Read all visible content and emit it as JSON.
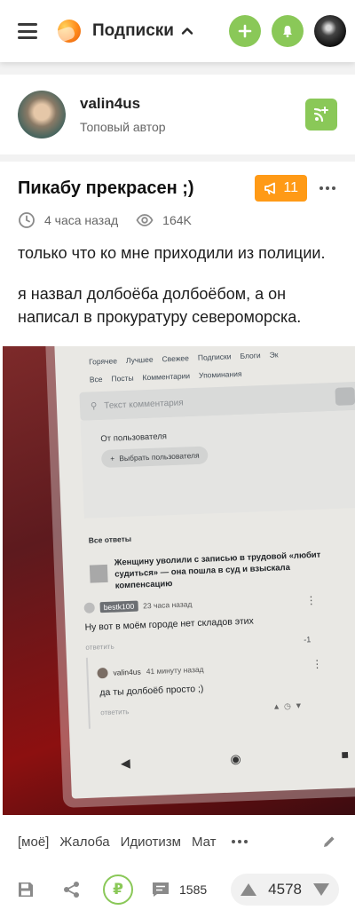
{
  "header": {
    "section_label": "Подписки",
    "icons": {
      "menu": "burger-menu-icon",
      "logo": "pikabu-logo",
      "chevron": "chevron-up-icon",
      "add": "plus-icon",
      "notifications": "bell-icon",
      "profile": "user-avatar"
    },
    "accent_color": "#8ac858"
  },
  "author": {
    "name": "valin4us",
    "rank": "Топовый автор",
    "subscribe_icon": "subscribe-rss-icon"
  },
  "story": {
    "title": "Пикабу прекрасен ;)",
    "rating_badge": "11",
    "rating_badge_color": "#ff9a16",
    "time_ago": "4 часа назад",
    "views": "164K",
    "paragraphs": [
      "только что ко мне приходили из полиции.",
      "я назвал долбоёба долбоёбом, а он написал в прокуратуру североморска."
    ]
  },
  "photo": {
    "nav_top": [
      "Горячее",
      "Лучшее",
      "Свежее",
      "Подписки",
      "Блоги",
      "Эк"
    ],
    "nav_sub": [
      "Все",
      "Посты",
      "Комментарии",
      "Упоминания"
    ],
    "search_placeholder": "Текст комментария",
    "filter_title": "От пользователя",
    "filter_button": "Выбрать пользователя",
    "all_answers": "Все ответы",
    "post_title": "Женщину уволили с записью в трудовой «любит судиться» — она пошла в суд и взыскала компенсацию",
    "comment1": {
      "user": "bestk100",
      "time": "23 часа назад",
      "text": "Ну вот в моём городе нет складов этих",
      "reply": "ответить",
      "score": "-1"
    },
    "comment2": {
      "user": "valin4us",
      "time": "41 минуту назад",
      "text": "да ты долбоёб просто ;)",
      "reply": "ответить"
    }
  },
  "tags": [
    "[моё]",
    "Жалоба",
    "Идиотизм",
    "Мат"
  ],
  "actions": {
    "comments_count": "1585",
    "score": "4578",
    "icons": {
      "save": "save-icon",
      "share": "share-icon",
      "donate": "ruble-icon",
      "comments": "comment-icon",
      "upvote": "arrow-up-icon",
      "downvote": "arrow-down-icon",
      "edit": "pencil-icon"
    }
  }
}
